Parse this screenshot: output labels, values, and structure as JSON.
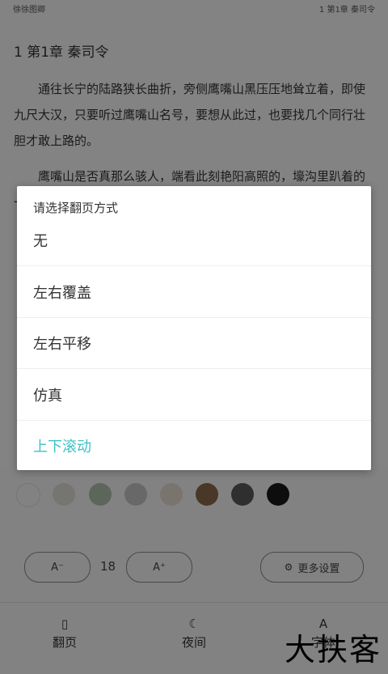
{
  "status_bar": {
    "left": "徐徐图卿",
    "right": "1 第1章 秦司令"
  },
  "chapter": {
    "title": "1 第1章 秦司令",
    "paragraphs": [
      "通往长宁的陆路狭长曲折，旁侧鹰嘴山黑压压地耸立着，即使九尺大汉，只要听过鹰嘴山名号，要想从此过，也要找几个同行壮胆才敢上路的。",
      "鹰嘴山是否真那么骇人，端看此刻艳阳高照的，壕沟里趴着的一溜"
    ]
  },
  "dialog": {
    "title": "请选择翻页方式",
    "options": [
      "无",
      "左右覆盖",
      "左右平移",
      "仿真",
      "上下滚动"
    ],
    "selected_color": "#3ec1c7"
  },
  "settings": {
    "swatch_colors": [
      "#f5f5f5",
      "#e0ddd8",
      "#b0c0ad",
      "#c4c4c4",
      "#e5dbd0",
      "#8b6a4b",
      "#5a5a5a",
      "#1a1a1a"
    ],
    "font_decrease_label": "A⁻",
    "font_size": "18",
    "font_increase_label": "A⁺",
    "more_settings_label": "更多设置"
  },
  "bottom_nav": {
    "page_turn": "翻页",
    "night": "夜间",
    "font": "字体"
  },
  "watermark": "大扶客"
}
